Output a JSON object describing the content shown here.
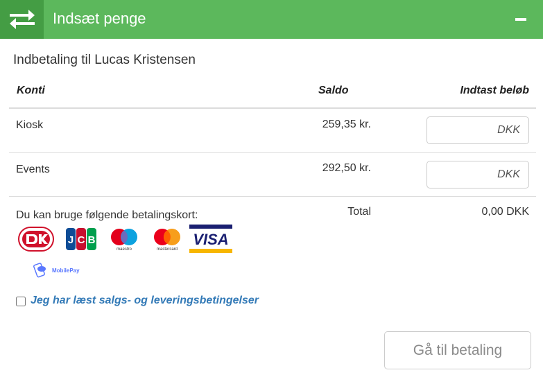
{
  "header": {
    "title": "Indsæt penge",
    "icon": "transfer-arrows-icon",
    "collapse_icon": "minus-icon",
    "color": "#5cb85c",
    "icon_bg": "#449d44"
  },
  "subtitle": "Indbetaling til Lucas Kristensen",
  "table": {
    "columns": [
      "Konti",
      "Saldo",
      "Indtast beløb"
    ],
    "rows": [
      {
        "account": "Kiosk",
        "balance": "259,35 kr.",
        "amount_placeholder": "DKK",
        "amount_value": ""
      },
      {
        "account": "Events",
        "balance": "292,50 kr.",
        "amount_placeholder": "DKK",
        "amount_value": ""
      }
    ]
  },
  "payment": {
    "label": "Du kan bruge følgende betalingskort:",
    "cards": [
      "Dankort",
      "JCB",
      "Maestro",
      "Mastercard",
      "VISA",
      "MobilePay"
    ],
    "total_label": "Total",
    "total_value": "0,00 DKK"
  },
  "terms": {
    "label": "Jeg har læst salgs- og leveringsbetingelser",
    "checked": false
  },
  "submit": {
    "label": "Gå til betaling",
    "enabled": false
  }
}
